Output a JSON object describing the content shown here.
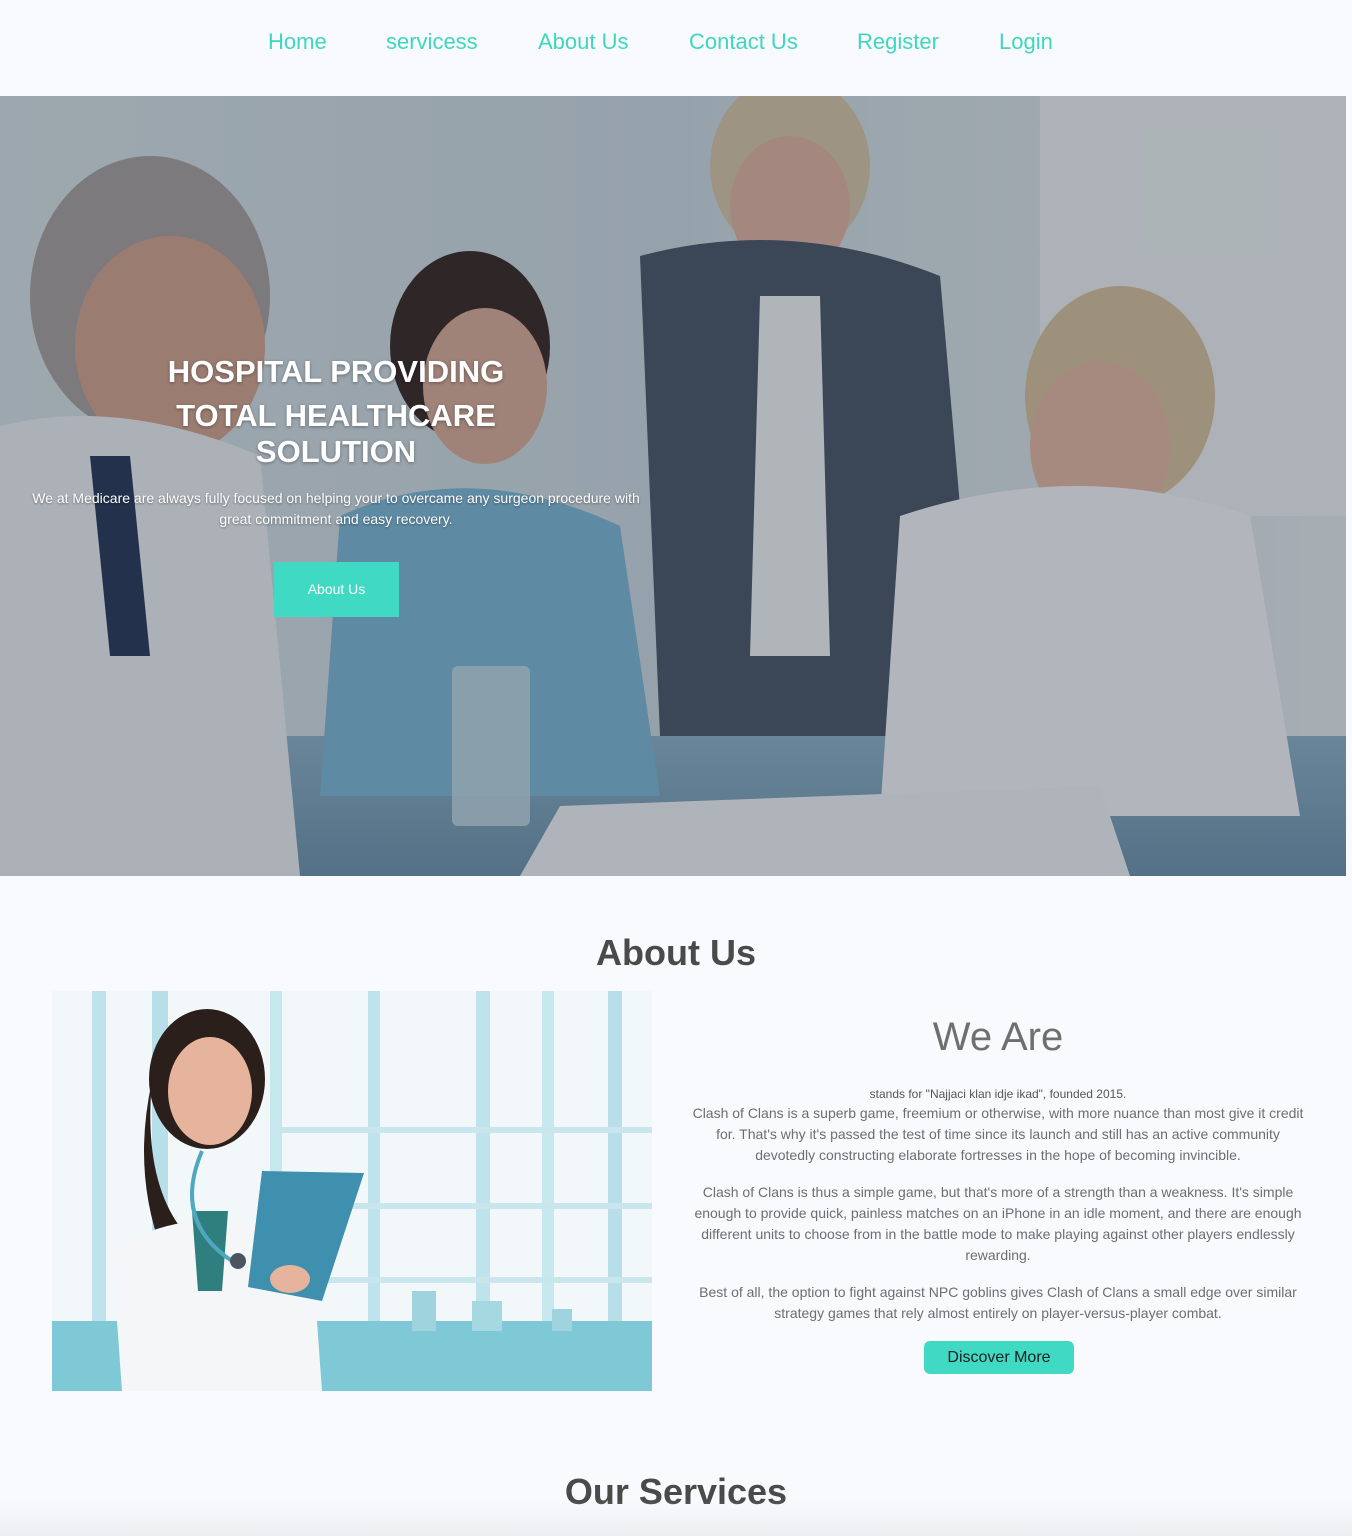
{
  "nav": {
    "items": [
      {
        "label": "Home"
      },
      {
        "label": "servicess"
      },
      {
        "label": "About Us"
      },
      {
        "label": "Contact Us"
      },
      {
        "label": "Register"
      },
      {
        "label": "Login"
      }
    ]
  },
  "hero": {
    "title_line1": "HOSPITAL PROVIDING",
    "title_line2": "TOTAL HEALTHCARE",
    "title_line3": "SOLUTION",
    "text": "We at Medicare are always fully focused on helping your to overcame any surgeon procedure with great commitment and easy recovery.",
    "button_label": "About Us"
  },
  "about": {
    "heading": "About Us",
    "subheading": "We Are",
    "tagline": "stands for \"Najjaci klan idje ikad\", founded 2015.",
    "paragraph1": "Clash of Clans is a superb game, freemium or otherwise, with more nuance than most give it credit for. That's why it's passed the test of time since its launch and still has an active community devotedly constructing elaborate fortresses in the hope of becoming invincible.",
    "paragraph2": "Clash of Clans is thus a simple game, but that's more of a strength than a weakness. It's simple enough to provide quick, painless matches on an iPhone in an idle moment, and there are enough different units to choose from in the battle mode to make playing against other players endlessly rewarding.",
    "paragraph3": "Best of all, the option to fight against NPC goblins gives Clash of Clans a small edge over similar strategy games that rely almost entirely on player-versus-player combat.",
    "button_label": "Discover More"
  },
  "services": {
    "heading": "Our Services"
  },
  "colors": {
    "accent": "#40d9c4",
    "nav_link": "#3fd6c0",
    "heading": "#4a4a4a",
    "body_text": "#6e6e6e",
    "page_bg": "#f9fafd"
  }
}
